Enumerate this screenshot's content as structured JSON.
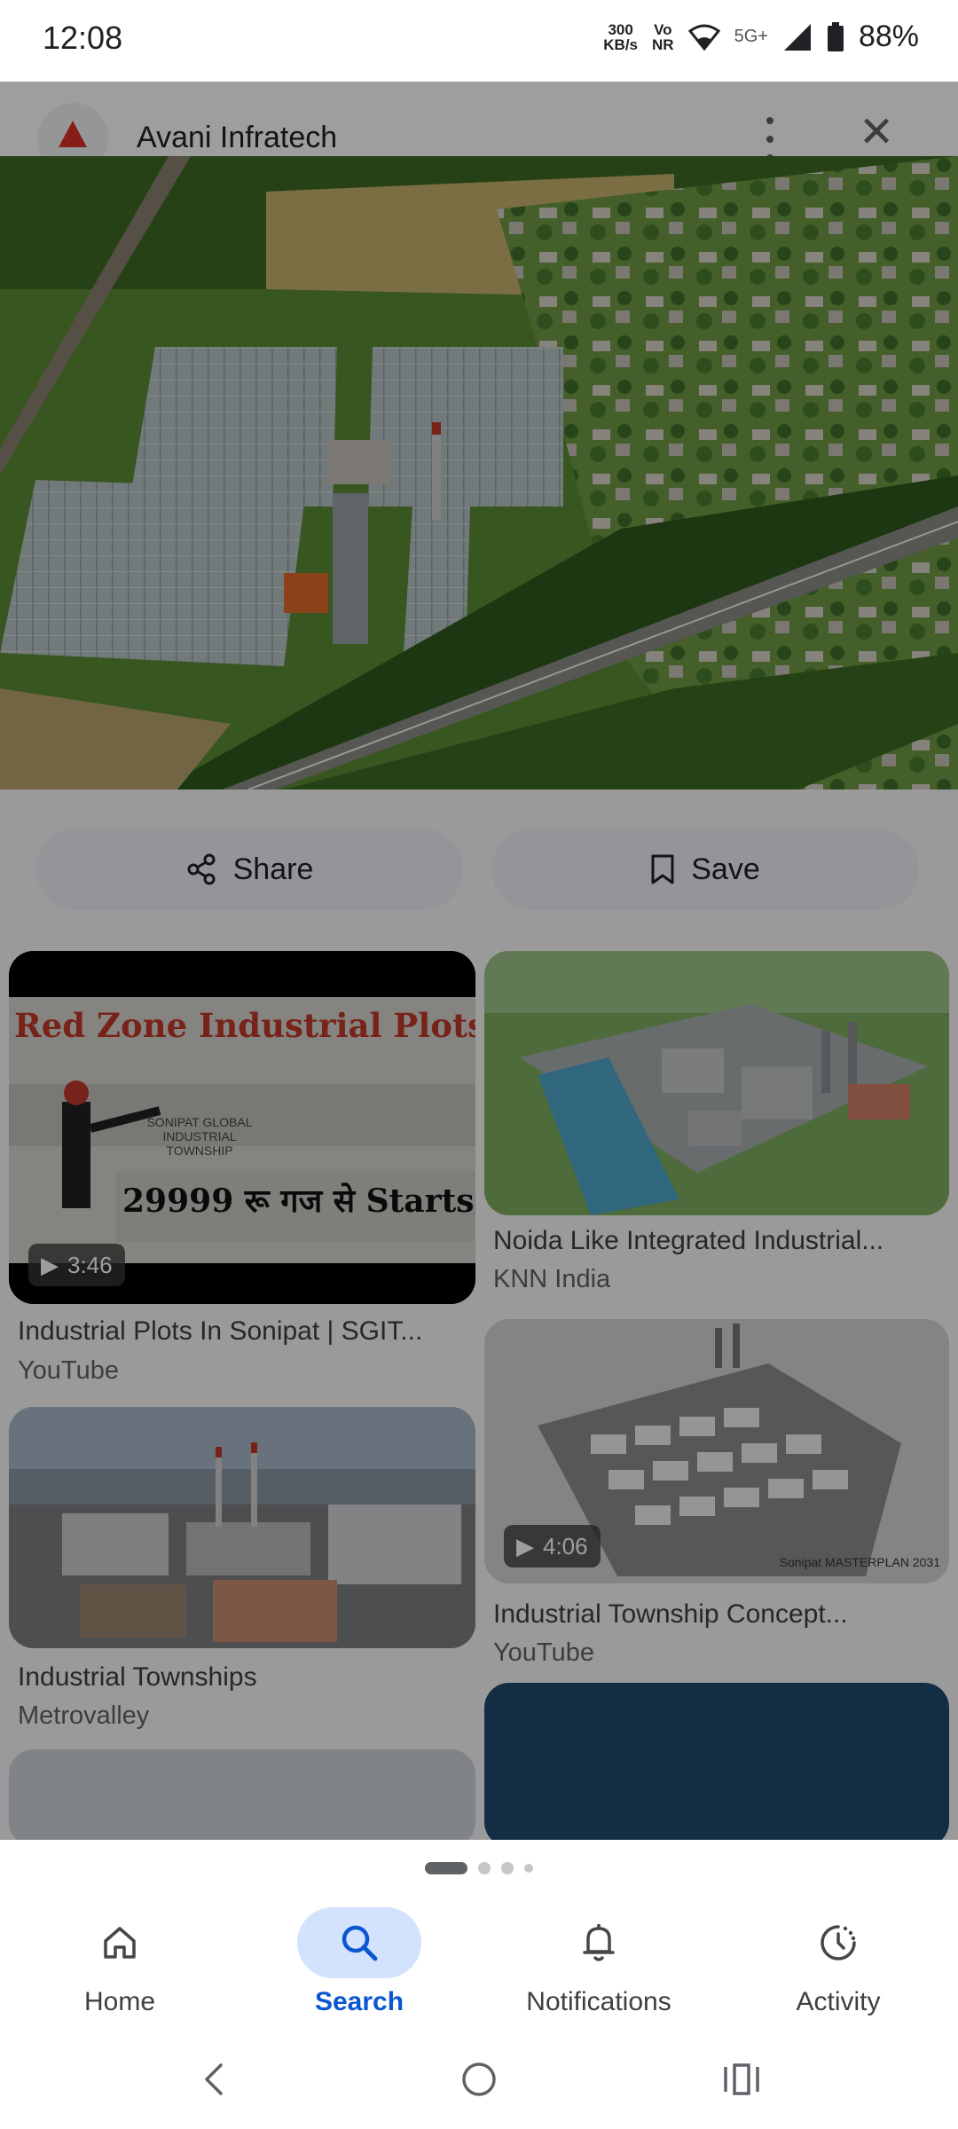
{
  "status_bar": {
    "time": "12:08",
    "net_speed_value": "300",
    "net_speed_unit": "KB/s",
    "volte": "Vo",
    "nr": "NR",
    "network_type": "5G+",
    "battery": "88%"
  },
  "header": {
    "title": "Avani Infratech",
    "logo_icon": "triangle-logo",
    "close_icon": "close-icon",
    "more_icon": "more-vert-icon"
  },
  "actions": {
    "share_label": "Share",
    "save_label": "Save"
  },
  "results": [
    {
      "title": "Industrial Plots In Sonipat | SGIT...",
      "source": "YouTube",
      "duration": "3:46",
      "thumb_heading": "Red Zone Industrial Plots",
      "thumb_text": "29999 रू गज से Starts",
      "thumb_sign": "SONIPAT GLOBAL INDUSTRIAL TOWNSHIP"
    },
    {
      "title": "Noida Like Integrated Industrial...",
      "source": "KNN India"
    },
    {
      "title": "Industrial Township Concept...",
      "source": "YouTube",
      "duration": "4:06",
      "thumb_text": "Sonipat MASTERPLAN 2031"
    },
    {
      "title": "Industrial Townships",
      "source": "Metrovalley"
    }
  ],
  "pager": {
    "count": 4,
    "active": 0
  },
  "bottom_nav": [
    {
      "label": "Home",
      "icon": "home-icon"
    },
    {
      "label": "Search",
      "icon": "search-icon",
      "active": true
    },
    {
      "label": "Notifications",
      "icon": "bell-icon"
    },
    {
      "label": "Activity",
      "icon": "activity-icon"
    }
  ],
  "colors": {
    "accent": "#0b57d0",
    "active_tab_bg": "#d3e3fd",
    "pill_bg": "#eef1f6"
  }
}
